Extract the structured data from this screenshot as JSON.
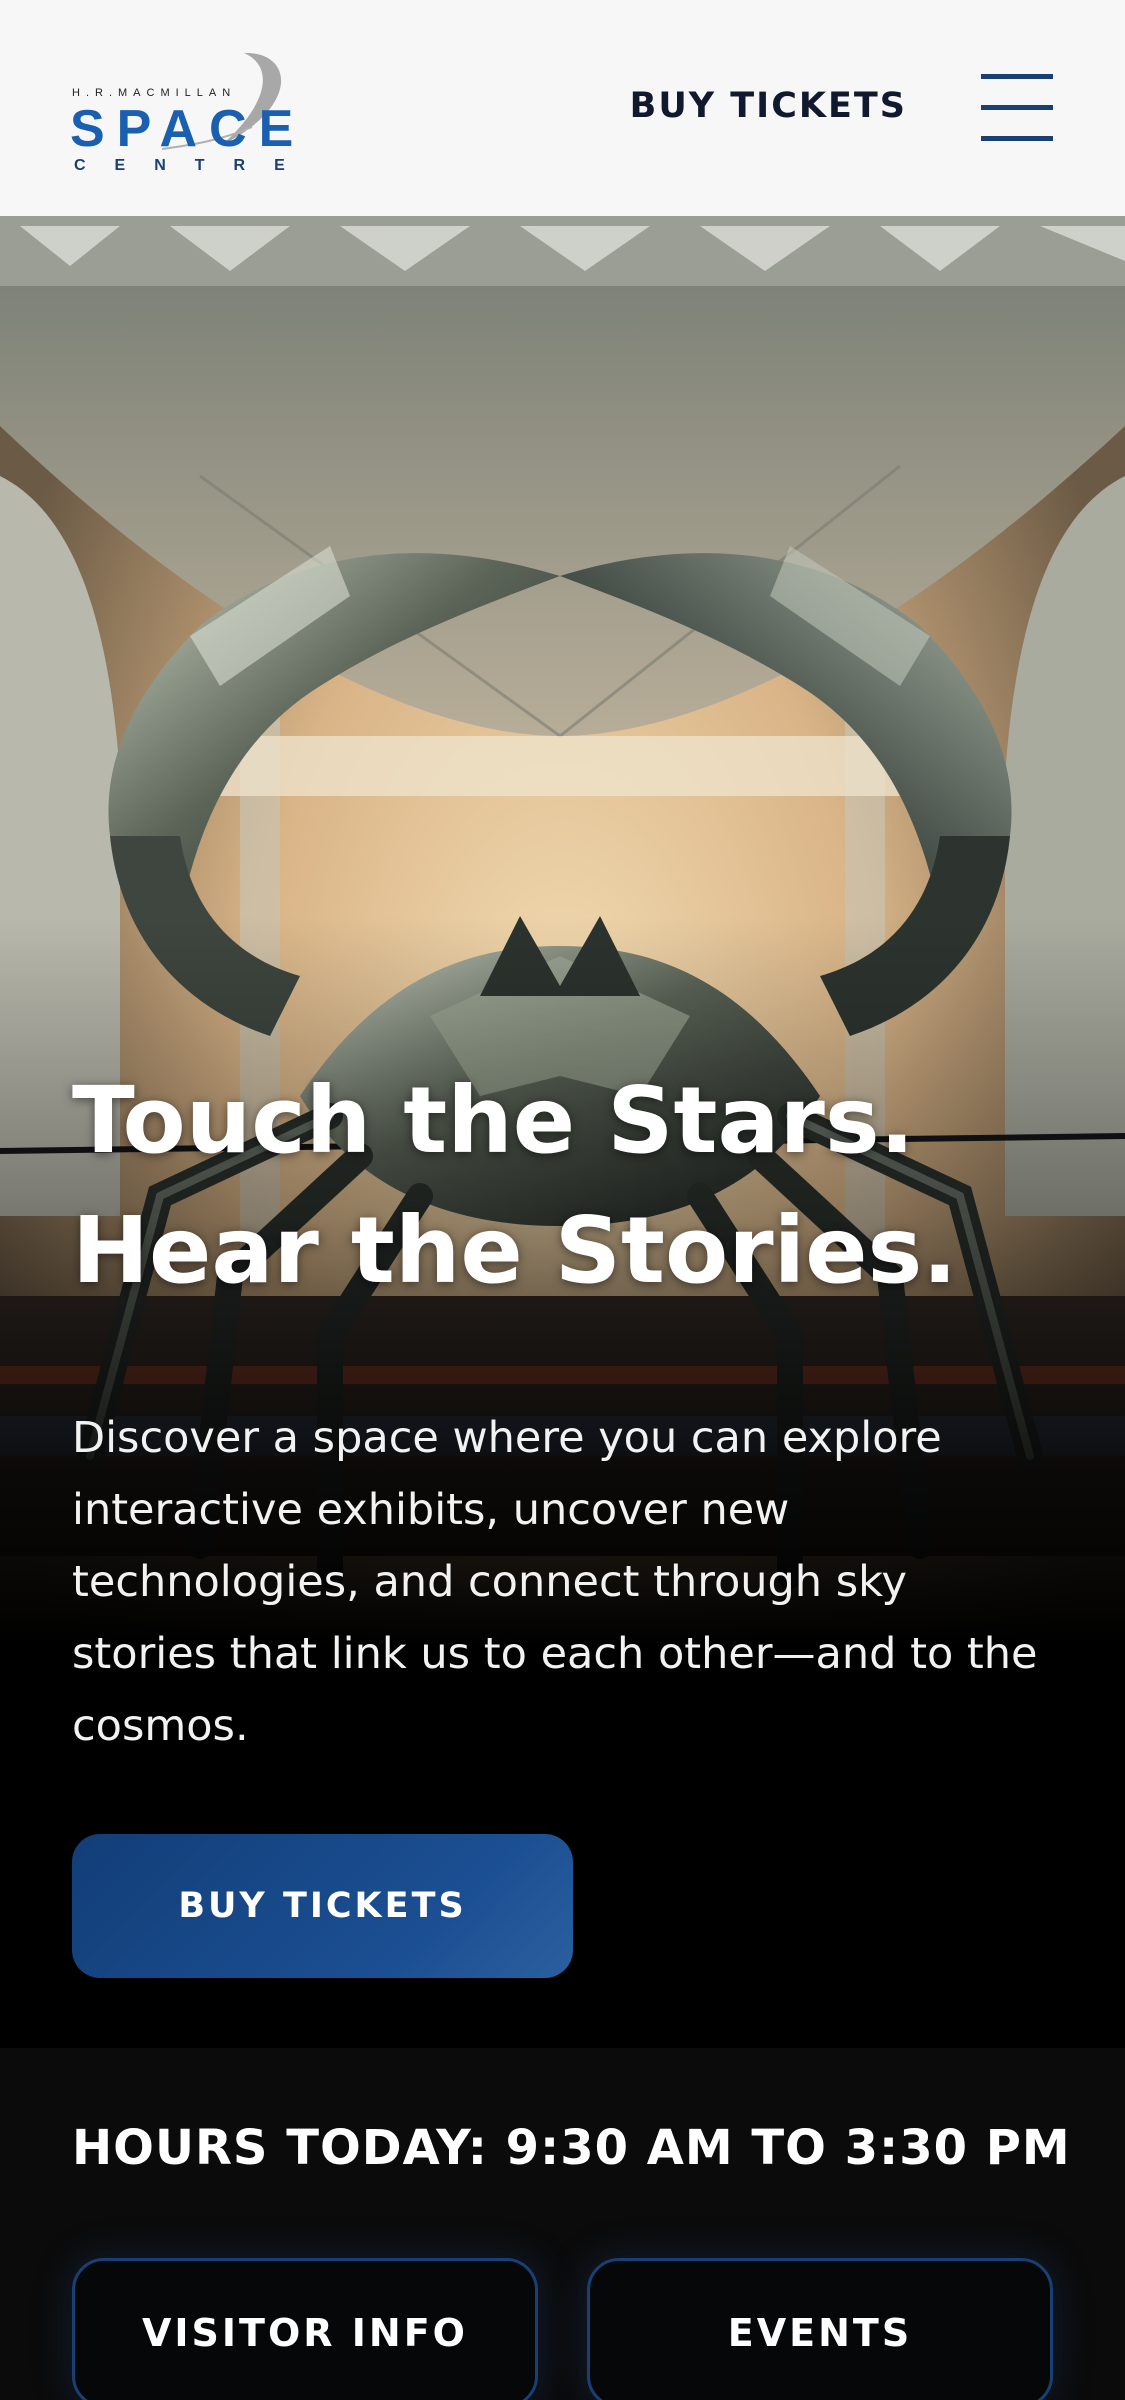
{
  "header": {
    "logo": {
      "top_line": "H.R.MACMILLAN",
      "main": "SPACE",
      "bottom_line": "CENTRE"
    },
    "buy_tickets_label": "BUY TICKETS",
    "menu_icon": "hamburger-menu-icon"
  },
  "hero": {
    "image_subject": "crab sculpture",
    "title_line1": "Touch the Stars.",
    "title_line2": "Hear the Stories.",
    "description": "Discover a space where you can explore interactive exhibits, uncover new technologies, and connect through sky stories that link us to each other—and to the cosmos.",
    "cta_label": "BUY TICKETS"
  },
  "hours": {
    "text": "HOURS TODAY: 9:30 AM TO 3:30 PM"
  },
  "quick_links": {
    "visitor_info_label": "VISITOR INFO",
    "events_label": "EVENTS"
  },
  "colors": {
    "brand_blue": "#1a5fb0",
    "navy": "#1a3f73",
    "header_bg": "#f7f7f7",
    "cta_bg": "#1b4f93",
    "hours_bg": "#0b0b0b"
  }
}
